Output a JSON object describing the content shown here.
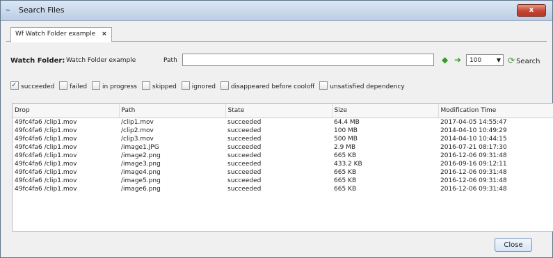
{
  "window": {
    "title": "Search Files",
    "close_label": "x"
  },
  "tab": {
    "label": "Wf Watch Folder example",
    "close_glyph": "×"
  },
  "toolbar": {
    "watch_folder_label": "Watch Folder:",
    "watch_folder_value": "Watch Folder example",
    "path_label": "Path",
    "path_value": "",
    "prev_icon": "arrow-left-icon",
    "next_icon": "arrow-right-icon",
    "page_size": "100",
    "search_label": "Search"
  },
  "filters": [
    {
      "label": "succeeded",
      "checked": true
    },
    {
      "label": "failed",
      "checked": false
    },
    {
      "label": "in progress",
      "checked": false
    },
    {
      "label": "skipped",
      "checked": false
    },
    {
      "label": "ignored",
      "checked": false
    },
    {
      "label": "disappeared before cooloff",
      "checked": false
    },
    {
      "label": "unsatisfied dependency",
      "checked": false
    }
  ],
  "table": {
    "columns": [
      "Drop",
      "Path",
      "State",
      "Size",
      "Modification Time"
    ],
    "rows": [
      [
        "49fc4fa6 /clip1.mov",
        "/clip1.mov",
        "succeeded",
        "64.4 MB",
        "2017-04-05 14:55:47"
      ],
      [
        "49fc4fa6 /clip1.mov",
        "/clip2.mov",
        "succeeded",
        "100 MB",
        "2014-04-10 10:49:29"
      ],
      [
        "49fc4fa6 /clip1.mov",
        "/clip3.mov",
        "succeeded",
        "500 MB",
        "2014-04-10 10:44:15"
      ],
      [
        "49fc4fa6 /clip1.mov",
        "/image1.JPG",
        "succeeded",
        "2.9 MB",
        "2016-07-21 08:17:30"
      ],
      [
        "49fc4fa6 /clip1.mov",
        "/image2.png",
        "succeeded",
        "665 KB",
        "2016-12-06 09:31:48"
      ],
      [
        "49fc4fa6 /clip1.mov",
        "/image3.png",
        "succeeded",
        "433.2 KB",
        "2016-09-16 09:12:11"
      ],
      [
        "49fc4fa6 /clip1.mov",
        "/image4.png",
        "succeeded",
        "665 KB",
        "2016-12-06 09:31:48"
      ],
      [
        "49fc4fa6 /clip1.mov",
        "/image5.png",
        "succeeded",
        "665 KB",
        "2016-12-06 09:31:48"
      ],
      [
        "49fc4fa6 /clip1.mov",
        "/image6.png",
        "succeeded",
        "665 KB",
        "2016-12-06 09:31:48"
      ]
    ]
  },
  "footer": {
    "close_label": "Close"
  }
}
